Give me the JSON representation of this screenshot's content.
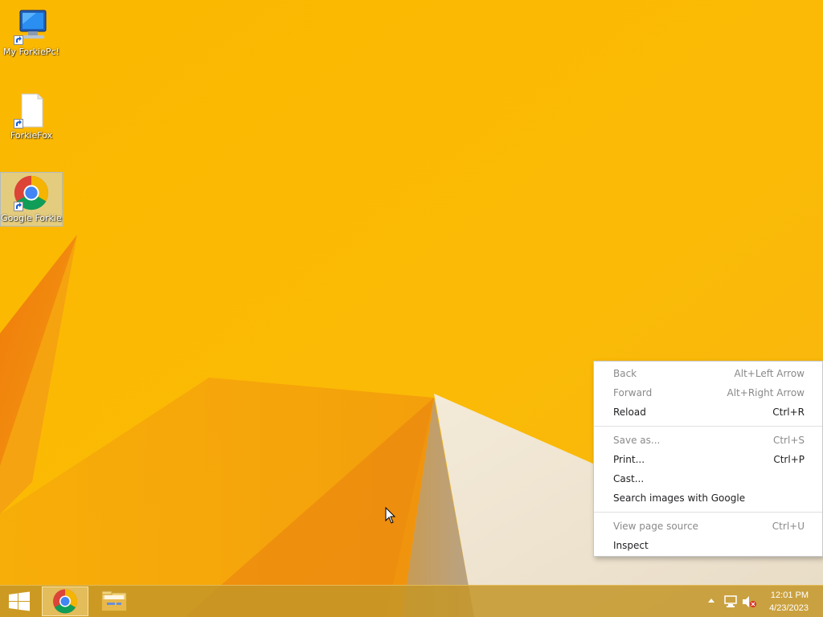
{
  "desktop": {
    "icons": [
      {
        "label": "My ForkiePc!",
        "icon": "computer-icon"
      },
      {
        "label": "ForkieFox",
        "icon": "blank-document-icon"
      },
      {
        "label": "Google Forkie",
        "icon": "chrome-icon",
        "selected": true
      }
    ]
  },
  "context_menu": {
    "items": [
      {
        "label": "Back",
        "shortcut": "Alt+Left Arrow",
        "enabled": false
      },
      {
        "label": "Forward",
        "shortcut": "Alt+Right Arrow",
        "enabled": false
      },
      {
        "label": "Reload",
        "shortcut": "Ctrl+R",
        "enabled": true
      },
      {
        "label": "Save as...",
        "shortcut": "Ctrl+S",
        "enabled": false
      },
      {
        "label": "Print...",
        "shortcut": "Ctrl+P",
        "enabled": true
      },
      {
        "label": "Cast...",
        "shortcut": "",
        "enabled": true
      },
      {
        "label": "Search images with Google",
        "shortcut": "",
        "enabled": true
      },
      {
        "label": "View page source",
        "shortcut": "Ctrl+U",
        "enabled": false
      },
      {
        "label": "Inspect",
        "shortcut": "",
        "enabled": true
      }
    ]
  },
  "taskbar": {
    "apps": [
      {
        "name": "chrome",
        "icon": "chrome-icon",
        "active": true
      },
      {
        "name": "file-explorer",
        "icon": "folder-icon",
        "active": false
      }
    ],
    "tray": {
      "icons": [
        "show-hidden-icons-icon",
        "network-icon",
        "volume-muted-icon"
      ]
    },
    "clock": {
      "time": "12:01 PM",
      "date": "4/23/2023"
    }
  },
  "colors": {
    "wallpaper_base": "#f9b400",
    "wallpaper_dark": "#ec8a0c",
    "wallpaper_light": "#f0e6d8",
    "taskbar": "#c49628"
  }
}
